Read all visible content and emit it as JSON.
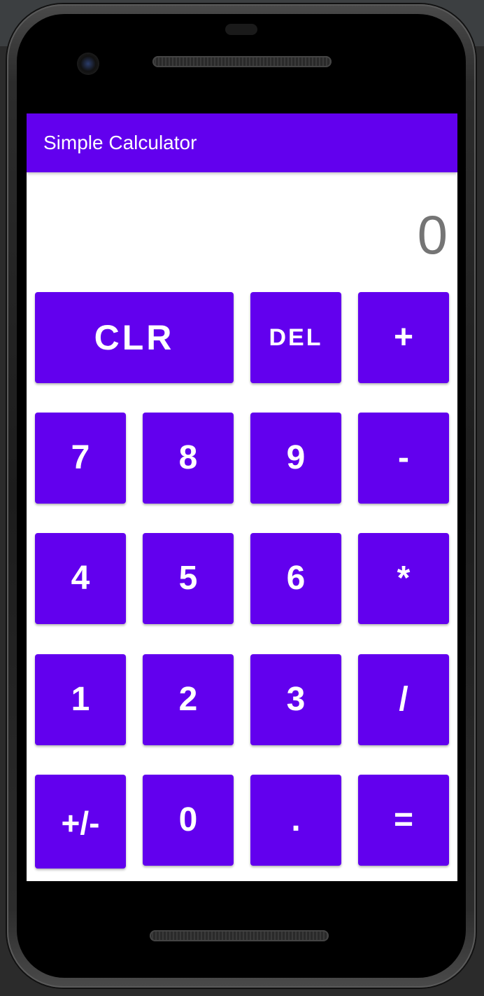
{
  "app": {
    "title": "Simple Calculator",
    "display_value": "0",
    "accent_color": "#6200ee"
  },
  "keypad": {
    "rows": [
      [
        "CLR",
        "DEL",
        "+"
      ],
      [
        "7",
        "8",
        "9",
        "-"
      ],
      [
        "4",
        "5",
        "6",
        "*"
      ],
      [
        "1",
        "2",
        "3",
        "/"
      ],
      [
        "+/-",
        "0",
        ".",
        "="
      ]
    ],
    "clear_label": "CLR",
    "delete_label": "DEL",
    "add_label": "+",
    "subtract_label": "-",
    "multiply_label": "*",
    "divide_label": "/",
    "plus_minus_label": "+/-",
    "decimal_label": ".",
    "equals_label": "=",
    "digits": {
      "d0": "0",
      "d1": "1",
      "d2": "2",
      "d3": "3",
      "d4": "4",
      "d5": "5",
      "d6": "6",
      "d7": "7",
      "d8": "8",
      "d9": "9"
    }
  }
}
